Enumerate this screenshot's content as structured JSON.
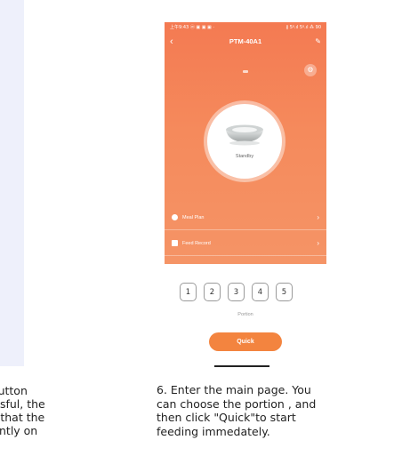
{
  "left_caption": {
    "lines": [
      "h\" button",
      "ccessful, the",
      "ows that the",
      "nstantly on"
    ]
  },
  "phone": {
    "status_bar": {
      "left": "上午9:43 ⓦ ▣ ▣ ▣ ·",
      "right": "∦ 5ᵍ.ıl 5ᵍ.ıl ⁂ 90"
    },
    "title": "PTM-40A1",
    "device_status": "Standby",
    "menu": [
      {
        "icon": "clock-icon",
        "label": "Meal Plan"
      },
      {
        "icon": "record-icon",
        "label": "Feed Record"
      }
    ],
    "portions": [
      "1",
      "2",
      "3",
      "4",
      "5"
    ],
    "portion_label": "Portion",
    "quick_label": "Quick"
  },
  "step_caption": {
    "lines": [
      "6. Enter the main page. You",
      "can choose the portion , and",
      "then click \"Quick\"to start",
      "feeding immedately."
    ]
  }
}
